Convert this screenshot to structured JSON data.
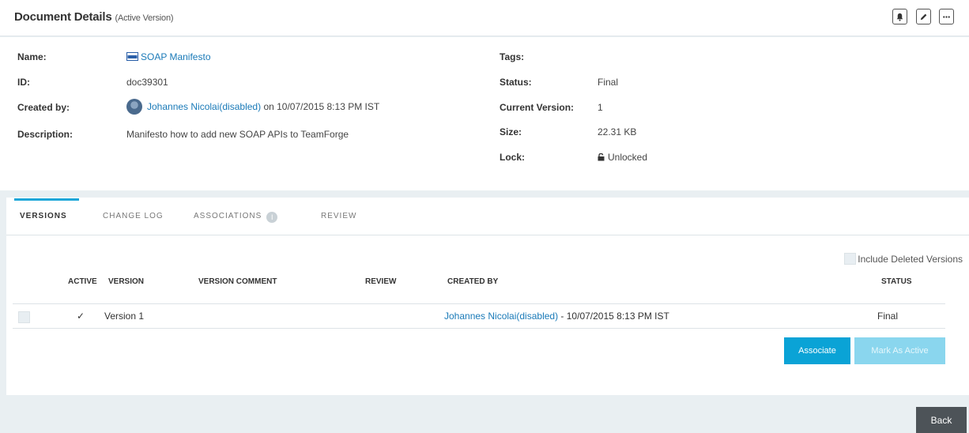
{
  "header": {
    "title": "Document Details",
    "subtitle": "(Active Version)"
  },
  "details": {
    "name_label": "Name:",
    "name_value": "SOAP Manifesto",
    "id_label": "ID:",
    "id_value": "doc39301",
    "created_by_label": "Created by:",
    "created_by_user": "Johannes Nicolai(disabled)",
    "created_by_date": "on 10/07/2015 8:13 PM IST",
    "description_label": "Description:",
    "description_value": "Manifesto how to add new SOAP APIs to TeamForge",
    "tags_label": "Tags:",
    "status_label": "Status:",
    "status_value": "Final",
    "current_version_label": "Current Version:",
    "current_version_value": "1",
    "size_label": "Size:",
    "size_value": "22.31 KB",
    "lock_label": "Lock:",
    "lock_value": "Unlocked"
  },
  "tabs": [
    {
      "label": "VERSIONS"
    },
    {
      "label": "CHANGE LOG"
    },
    {
      "label": "ASSOCIATIONS"
    },
    {
      "label": "REVIEW"
    }
  ],
  "info_badge": "i",
  "include_deleted_label": "Include Deleted Versions",
  "table": {
    "headers": {
      "active": "ACTIVE",
      "version": "VERSION",
      "version_comment": "VERSION COMMENT",
      "review": "REVIEW",
      "created_by": "CREATED BY",
      "status": "STATUS"
    },
    "rows": [
      {
        "active_mark": "✓",
        "version": "Version 1",
        "version_comment": "",
        "review": "",
        "created_by_user": "Johannes Nicolai(disabled)",
        "created_by_date": " - 10/07/2015 8:13 PM IST",
        "status": "Final"
      }
    ]
  },
  "buttons": {
    "associate": "Associate",
    "mark_as_active": "Mark As Active",
    "back": "Back"
  },
  "colors": {
    "link": "#1a7ab8",
    "primary": "#0aa3d6",
    "primary_disabled": "#8ad6ee",
    "tab_accent": "#1aa6d8",
    "back_button": "#4d5358"
  }
}
